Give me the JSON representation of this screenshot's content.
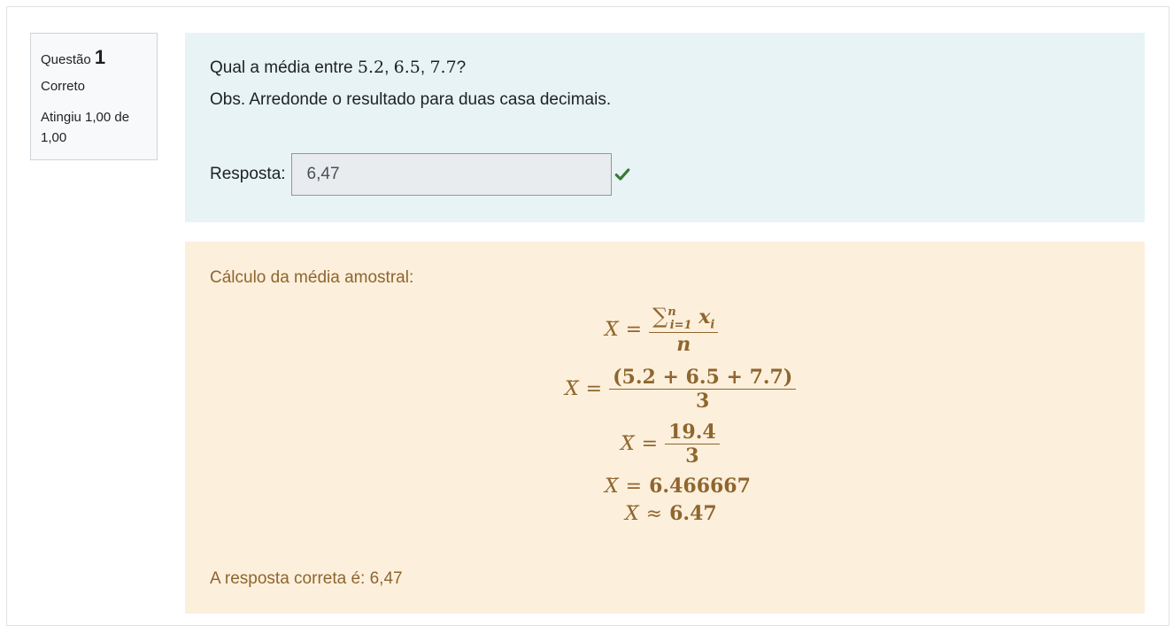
{
  "info": {
    "question_label": "Questão",
    "question_number": "1",
    "state": "Correto",
    "grade": "Atingiu 1,00 de 1,00"
  },
  "question": {
    "prefix": "Qual a média entre ",
    "value1": "5.2",
    "sep1": ", ",
    "value2": "6.5",
    "sep2": ", ",
    "value3": "7.7",
    "suffix": "?",
    "note": "Obs. Arredonde o resultado para duas casa decimais.",
    "answer_label": "Resposta:",
    "answer_value": "6,47",
    "correct_icon": "check-icon",
    "correct_color": "#357a32"
  },
  "feedback": {
    "title": "Cálculo da média amostral:",
    "eq1": {
      "lhs": "X",
      "eq": "=",
      "sum_sym": "∑",
      "sum_lower": "i=1",
      "sum_upper": "n",
      "sum_term": "x",
      "sum_term_sub": "i",
      "den": "n"
    },
    "eq2": {
      "lhs": "X",
      "eq": "=",
      "num": "(5.2 + 6.5 + 7.7)",
      "den": "3"
    },
    "eq3": {
      "lhs": "X",
      "eq": "=",
      "num": "19.4",
      "den": "3"
    },
    "eq4": {
      "lhs": "X",
      "eq": "=",
      "rhs": "6.466667"
    },
    "eq5": {
      "lhs": "X",
      "eq": "≈",
      "rhs": "6.47"
    },
    "correct_answer": "A resposta correta é: 6,47"
  },
  "colors": {
    "formulation_bg": "#e7f3f5",
    "feedback_bg": "#fcefdc",
    "feedback_text": "#8e662e",
    "info_bg": "#f8f9fa"
  }
}
